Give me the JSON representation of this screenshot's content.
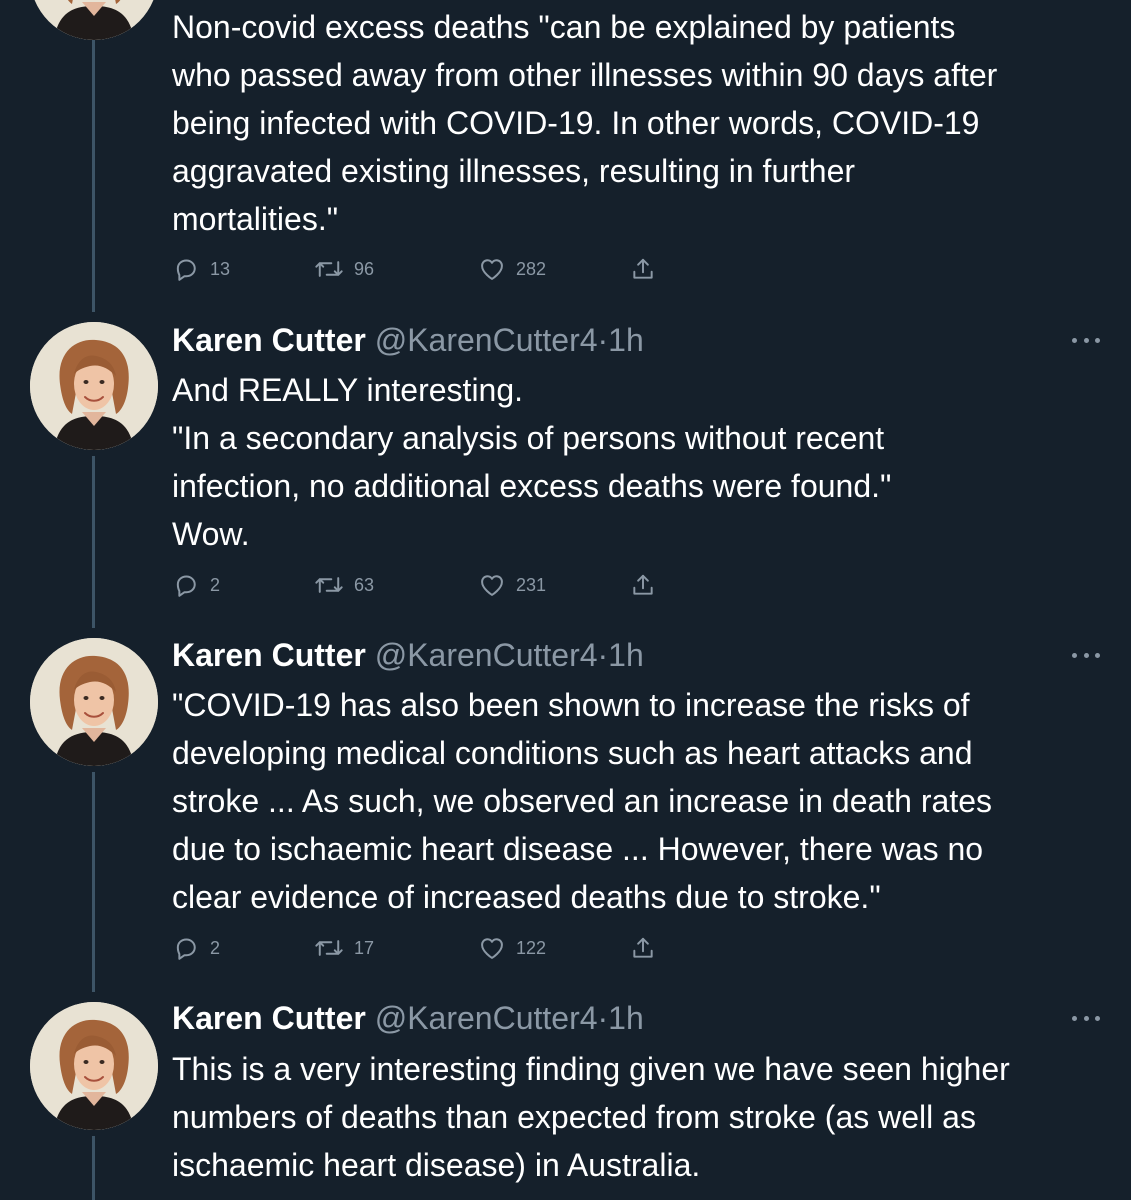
{
  "thread": [
    {
      "lines": [
        "Non-covid excess deaths \"can be explained by patients",
        "who passed away from other illnesses within 90 days after",
        "being infected with COVID-19. In other words, COVID-19",
        "aggravated existing illnesses, resulting in further",
        "mortalities.\""
      ],
      "replies": "13",
      "retweets": "96",
      "likes": "282"
    },
    {
      "name": "Karen Cutter",
      "handle": "@KarenCutter4",
      "dot": "·",
      "time": "1h",
      "lines": [
        "And REALLY interesting.",
        "\"In a secondary analysis of persons without recent",
        "infection, no additional excess deaths were found.\"",
        "Wow."
      ],
      "replies": "2",
      "retweets": "63",
      "likes": "231"
    },
    {
      "name": "Karen Cutter",
      "handle": "@KarenCutter4",
      "dot": "·",
      "time": "1h",
      "lines": [
        "\"COVID-19 has also been shown to increase the risks of",
        "developing medical conditions such as heart attacks and",
        "stroke ... As such, we observed an increase in death rates",
        "due to ischaemic heart disease ... However, there was no",
        "clear evidence of increased deaths due to stroke.\""
      ],
      "replies": "2",
      "retweets": "17",
      "likes": "122"
    },
    {
      "name": "Karen Cutter",
      "handle": "@KarenCutter4",
      "dot": "·",
      "time": "1h",
      "lines": [
        "This is a very interesting finding given we have seen higher",
        "numbers of deaths than expected from stroke (as well as",
        "ischaemic heart disease) in Australia."
      ]
    }
  ],
  "icons": {
    "reply": "reply-icon",
    "retweet": "retweet-icon",
    "like": "like-icon",
    "share": "share-icon",
    "more": "more-icon"
  },
  "colors": {
    "background": "#15202b",
    "text": "#ffffff",
    "secondary_text": "#8b98a5",
    "thread_line": "#3d5466"
  }
}
